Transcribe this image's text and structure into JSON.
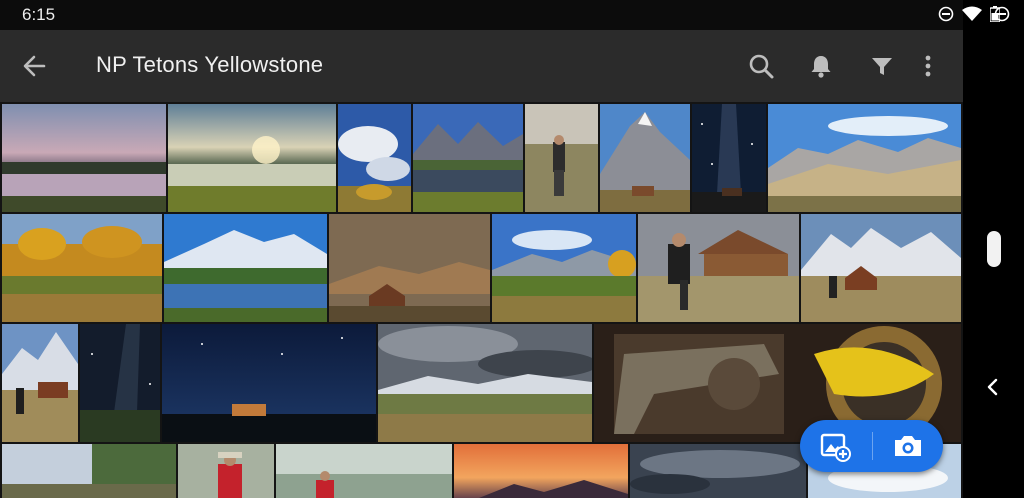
{
  "status": {
    "time": "6:15"
  },
  "appbar": {
    "title": "NP Tetons Yellowstone"
  },
  "colors": {
    "appbar": "#2b2b2b",
    "fab": "#1e73e8",
    "background": "#101010"
  },
  "icons": [
    "arrow-back-icon",
    "search-icon",
    "bell-icon",
    "filter-icon",
    "more-vert-icon",
    "add-photo-icon",
    "camera-icon",
    "do-not-disturb-icon",
    "wifi-icon",
    "battery-icon"
  ],
  "photos": [
    "sunset-lake",
    "marsh-sunrise",
    "clouds-sky",
    "river-mountains",
    "photographer-field",
    "teton-barn",
    "milky-way-barn",
    "mountain-range",
    "autumn-aspens",
    "mountain-reflection",
    "dusk-barn",
    "pond-peaks",
    "photographer-barn",
    "peaks-barn",
    "peak-photographer",
    "night-sky",
    "night-barn",
    "storm-clouds",
    "revolver",
    "river-trees",
    "angler",
    "waterfall",
    "red-sunset",
    "dark-clouds",
    "bright-sky"
  ]
}
